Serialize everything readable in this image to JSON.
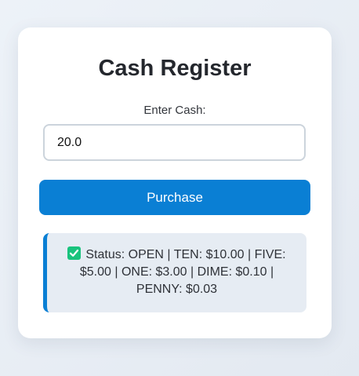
{
  "app": {
    "title": "Cash Register"
  },
  "form": {
    "label": "Enter Cash:",
    "cash_value": "20.0",
    "purchase_label": "Purchase"
  },
  "status": {
    "icon": "check-icon",
    "text": "Status: OPEN | TEN: $10.00 | FIVE: $5.00 | ONE: $3.00 | DIME: $0.10 | PENNY: $0.03"
  },
  "colors": {
    "accent": "#0a7fd4",
    "status_background": "#e6ecf3",
    "check": "#19c37d"
  }
}
